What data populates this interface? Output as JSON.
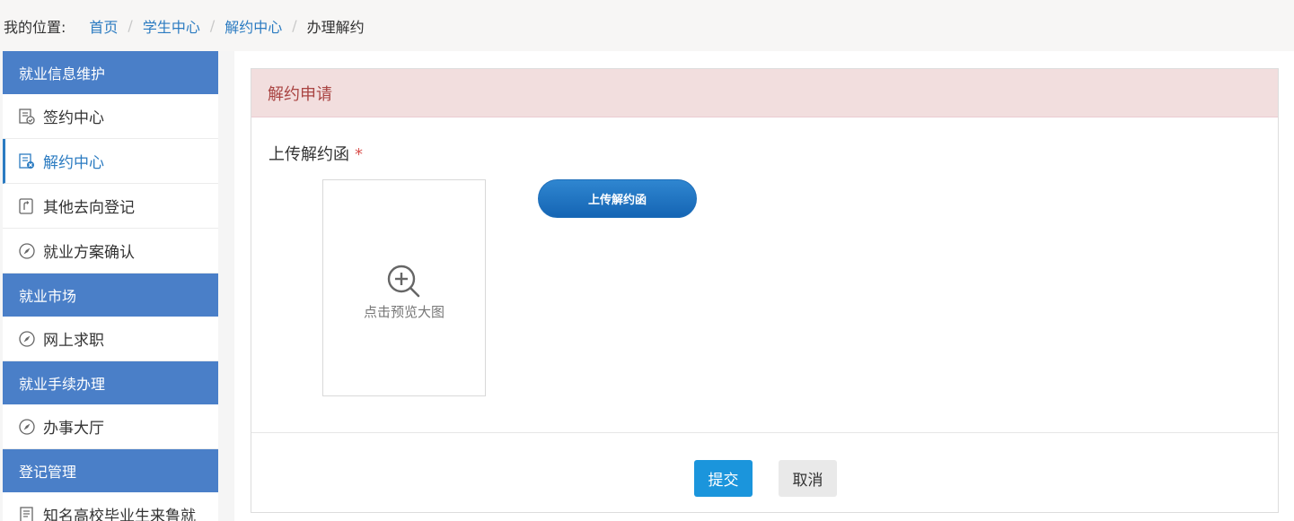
{
  "breadcrumb": {
    "prefix": "我的位置:",
    "items": [
      "首页",
      "学生中心",
      "解约中心",
      "办理解约"
    ],
    "separator": "/"
  },
  "sidebar": {
    "groups": [
      {
        "title": "就业信息维护",
        "items": [
          {
            "label": "签约中心",
            "icon": "contract-check-icon"
          },
          {
            "label": "解约中心",
            "icon": "contract-cancel-icon",
            "active": true
          },
          {
            "label": "其他去向登记",
            "icon": "register-icon"
          },
          {
            "label": "就业方案确认",
            "icon": "compass-icon"
          }
        ]
      },
      {
        "title": "就业市场",
        "items": [
          {
            "label": "网上求职",
            "icon": "compass-icon"
          }
        ]
      },
      {
        "title": "就业手续办理",
        "items": [
          {
            "label": "办事大厅",
            "icon": "compass-icon"
          }
        ]
      },
      {
        "title": "登记管理",
        "items": [
          {
            "label": "知名高校毕业生来鲁就",
            "icon": "document-icon"
          }
        ]
      }
    ]
  },
  "panel": {
    "title": "解约申请",
    "field_label": "上传解约函",
    "required_mark": "*",
    "preview_text": "点击预览大图",
    "upload_button": "上传解约函",
    "submit_button": "提交",
    "cancel_button": "取消"
  },
  "colors": {
    "sidebar_header": "#4a7fc8",
    "panel_header_bg": "#f2dede",
    "panel_header_text": "#a94442",
    "link": "#2b7bc1",
    "submit": "#1b95dc"
  }
}
